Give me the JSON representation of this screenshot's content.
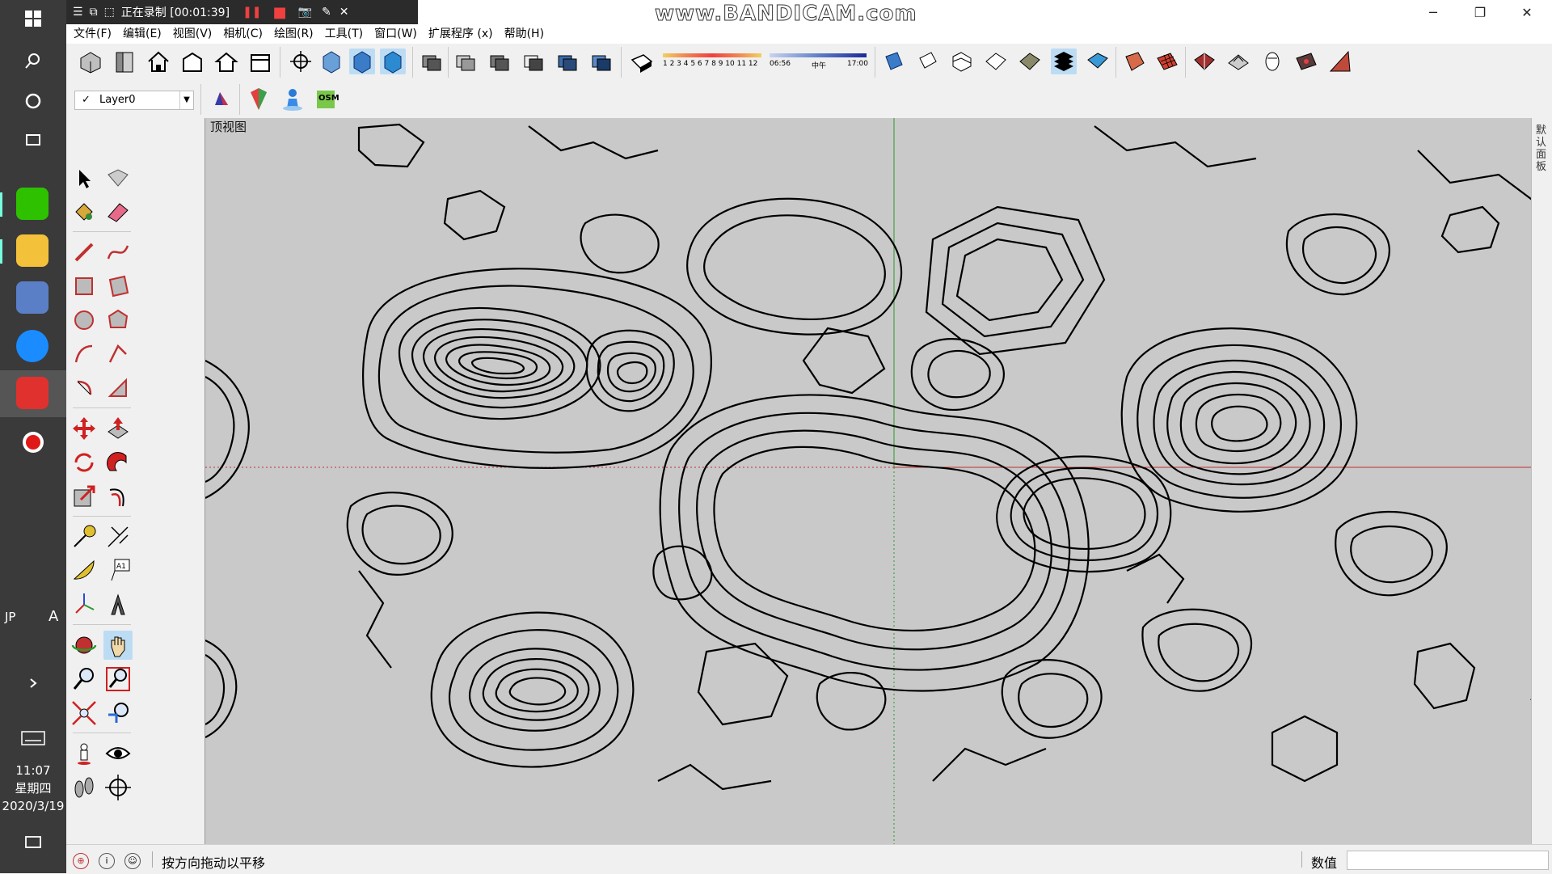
{
  "taskbar": {
    "clock_time": "11:07",
    "clock_day": "星期四",
    "clock_date": "2020/3/19",
    "ime_label": "JP",
    "ime_a": "A"
  },
  "recorder": {
    "status": "正在录制 [00:01:39]",
    "watermark": "www.BANDICAM.com"
  },
  "window_controls": {
    "minimize": "─",
    "restore": "❐",
    "close": "✕"
  },
  "menu": [
    "文件(F)",
    "编辑(E)",
    "视图(V)",
    "相机(C)",
    "绘图(R)",
    "工具(T)",
    "窗口(W)",
    "扩展程序 (x)",
    "帮助(H)"
  ],
  "shadow_bar": {
    "months": "1 2 3 4 5 6 7 8 9 10 11 12",
    "time_start": "06:56",
    "time_mid": "中午",
    "time_end": "17:00"
  },
  "layer": {
    "name": "Layer0",
    "check": "✓"
  },
  "osm_label": "OSM",
  "viewport": {
    "scene_label": "顶视图"
  },
  "tray": {
    "label": "默认面板"
  },
  "status": {
    "hint": "按方向拖动以平移",
    "measure_label": "数值",
    "measure_value": ""
  },
  "colors": {
    "accent": "#bcdcf4",
    "background": "#c9c9c9",
    "contour": "#000000",
    "axis_red": "#c03030",
    "axis_green": "#2a9a2a"
  }
}
